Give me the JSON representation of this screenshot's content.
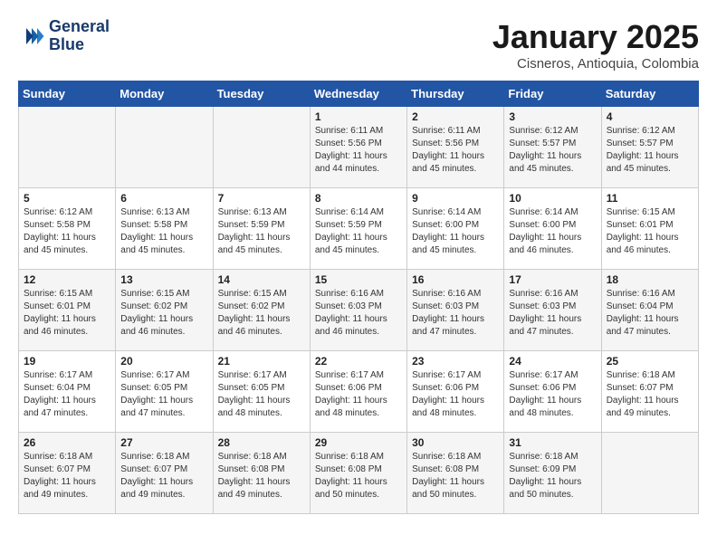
{
  "logo": {
    "line1": "General",
    "line2": "Blue"
  },
  "title": "January 2025",
  "location": "Cisneros, Antioquia, Colombia",
  "weekdays": [
    "Sunday",
    "Monday",
    "Tuesday",
    "Wednesday",
    "Thursday",
    "Friday",
    "Saturday"
  ],
  "weeks": [
    [
      {
        "day": "",
        "info": ""
      },
      {
        "day": "",
        "info": ""
      },
      {
        "day": "",
        "info": ""
      },
      {
        "day": "1",
        "info": "Sunrise: 6:11 AM\nSunset: 5:56 PM\nDaylight: 11 hours\nand 44 minutes."
      },
      {
        "day": "2",
        "info": "Sunrise: 6:11 AM\nSunset: 5:56 PM\nDaylight: 11 hours\nand 45 minutes."
      },
      {
        "day": "3",
        "info": "Sunrise: 6:12 AM\nSunset: 5:57 PM\nDaylight: 11 hours\nand 45 minutes."
      },
      {
        "day": "4",
        "info": "Sunrise: 6:12 AM\nSunset: 5:57 PM\nDaylight: 11 hours\nand 45 minutes."
      }
    ],
    [
      {
        "day": "5",
        "info": "Sunrise: 6:12 AM\nSunset: 5:58 PM\nDaylight: 11 hours\nand 45 minutes."
      },
      {
        "day": "6",
        "info": "Sunrise: 6:13 AM\nSunset: 5:58 PM\nDaylight: 11 hours\nand 45 minutes."
      },
      {
        "day": "7",
        "info": "Sunrise: 6:13 AM\nSunset: 5:59 PM\nDaylight: 11 hours\nand 45 minutes."
      },
      {
        "day": "8",
        "info": "Sunrise: 6:14 AM\nSunset: 5:59 PM\nDaylight: 11 hours\nand 45 minutes."
      },
      {
        "day": "9",
        "info": "Sunrise: 6:14 AM\nSunset: 6:00 PM\nDaylight: 11 hours\nand 45 minutes."
      },
      {
        "day": "10",
        "info": "Sunrise: 6:14 AM\nSunset: 6:00 PM\nDaylight: 11 hours\nand 46 minutes."
      },
      {
        "day": "11",
        "info": "Sunrise: 6:15 AM\nSunset: 6:01 PM\nDaylight: 11 hours\nand 46 minutes."
      }
    ],
    [
      {
        "day": "12",
        "info": "Sunrise: 6:15 AM\nSunset: 6:01 PM\nDaylight: 11 hours\nand 46 minutes."
      },
      {
        "day": "13",
        "info": "Sunrise: 6:15 AM\nSunset: 6:02 PM\nDaylight: 11 hours\nand 46 minutes."
      },
      {
        "day": "14",
        "info": "Sunrise: 6:15 AM\nSunset: 6:02 PM\nDaylight: 11 hours\nand 46 minutes."
      },
      {
        "day": "15",
        "info": "Sunrise: 6:16 AM\nSunset: 6:03 PM\nDaylight: 11 hours\nand 46 minutes."
      },
      {
        "day": "16",
        "info": "Sunrise: 6:16 AM\nSunset: 6:03 PM\nDaylight: 11 hours\nand 47 minutes."
      },
      {
        "day": "17",
        "info": "Sunrise: 6:16 AM\nSunset: 6:03 PM\nDaylight: 11 hours\nand 47 minutes."
      },
      {
        "day": "18",
        "info": "Sunrise: 6:16 AM\nSunset: 6:04 PM\nDaylight: 11 hours\nand 47 minutes."
      }
    ],
    [
      {
        "day": "19",
        "info": "Sunrise: 6:17 AM\nSunset: 6:04 PM\nDaylight: 11 hours\nand 47 minutes."
      },
      {
        "day": "20",
        "info": "Sunrise: 6:17 AM\nSunset: 6:05 PM\nDaylight: 11 hours\nand 47 minutes."
      },
      {
        "day": "21",
        "info": "Sunrise: 6:17 AM\nSunset: 6:05 PM\nDaylight: 11 hours\nand 48 minutes."
      },
      {
        "day": "22",
        "info": "Sunrise: 6:17 AM\nSunset: 6:06 PM\nDaylight: 11 hours\nand 48 minutes."
      },
      {
        "day": "23",
        "info": "Sunrise: 6:17 AM\nSunset: 6:06 PM\nDaylight: 11 hours\nand 48 minutes."
      },
      {
        "day": "24",
        "info": "Sunrise: 6:17 AM\nSunset: 6:06 PM\nDaylight: 11 hours\nand 48 minutes."
      },
      {
        "day": "25",
        "info": "Sunrise: 6:18 AM\nSunset: 6:07 PM\nDaylight: 11 hours\nand 49 minutes."
      }
    ],
    [
      {
        "day": "26",
        "info": "Sunrise: 6:18 AM\nSunset: 6:07 PM\nDaylight: 11 hours\nand 49 minutes."
      },
      {
        "day": "27",
        "info": "Sunrise: 6:18 AM\nSunset: 6:07 PM\nDaylight: 11 hours\nand 49 minutes."
      },
      {
        "day": "28",
        "info": "Sunrise: 6:18 AM\nSunset: 6:08 PM\nDaylight: 11 hours\nand 49 minutes."
      },
      {
        "day": "29",
        "info": "Sunrise: 6:18 AM\nSunset: 6:08 PM\nDaylight: 11 hours\nand 50 minutes."
      },
      {
        "day": "30",
        "info": "Sunrise: 6:18 AM\nSunset: 6:08 PM\nDaylight: 11 hours\nand 50 minutes."
      },
      {
        "day": "31",
        "info": "Sunrise: 6:18 AM\nSunset: 6:09 PM\nDaylight: 11 hours\nand 50 minutes."
      },
      {
        "day": "",
        "info": ""
      }
    ]
  ]
}
